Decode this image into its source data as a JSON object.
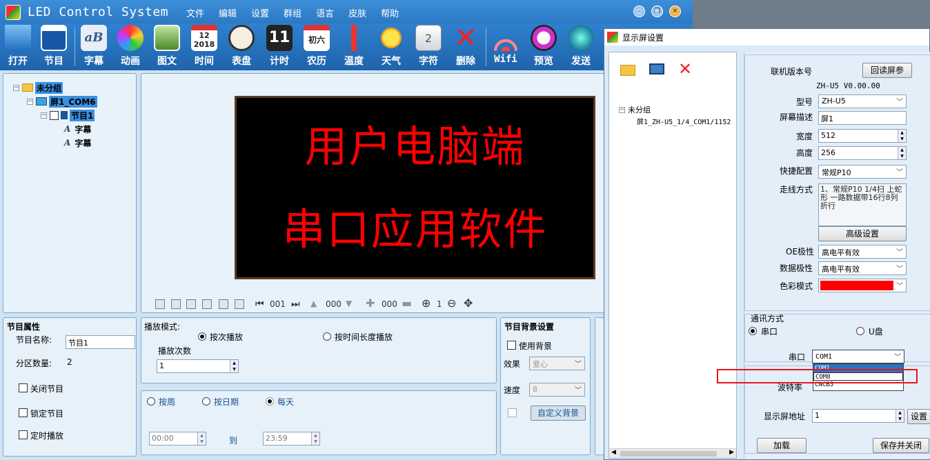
{
  "app": {
    "title": "LED Control System",
    "menu": [
      "文件",
      "编辑",
      "设置",
      "群组",
      "语言",
      "皮肤",
      "帮助"
    ],
    "win_controls": [
      "minimize-icon",
      "restore-icon",
      "close-icon"
    ]
  },
  "toolbar": [
    {
      "label": "打开",
      "icon": "open-folder-icon"
    },
    {
      "label": "节目",
      "icon": "program-icon"
    },
    {
      "label": "字幕",
      "icon": "subtitle-icon"
    },
    {
      "label": "动画",
      "icon": "animation-icon"
    },
    {
      "label": "图文",
      "icon": "image-text-icon"
    },
    {
      "label": "时间",
      "icon": "calendar-icon",
      "text": "12\n2018"
    },
    {
      "label": "表盘",
      "icon": "clock-icon"
    },
    {
      "label": "计时",
      "icon": "timer-icon",
      "text": "11"
    },
    {
      "label": "农历",
      "icon": "lunar-calendar-icon",
      "text": "初六"
    },
    {
      "label": "温度",
      "icon": "thermometer-icon"
    },
    {
      "label": "天气",
      "icon": "sun-icon"
    },
    {
      "label": "字符",
      "icon": "character-icon"
    },
    {
      "label": "删除",
      "icon": "delete-icon"
    },
    {
      "label": "Wifi",
      "icon": "wifi-icon"
    },
    {
      "label": "预览",
      "icon": "preview-icon"
    },
    {
      "label": "发送",
      "icon": "send-icon"
    }
  ],
  "tree": {
    "group": "未分组",
    "screen": "屏1_COM6",
    "program": "节目1",
    "items": [
      "字幕",
      "字幕"
    ]
  },
  "preview": {
    "line1": "用户电脑端",
    "line2": "串口应用软件"
  },
  "editbar": {
    "v1": "001",
    "v2": "000",
    "v3": "000",
    "zoom": "1"
  },
  "program_props": {
    "title": "节目属性",
    "name_label": "节目名称:",
    "name_value": "节目1",
    "count_label": "分区数量:",
    "count_value": "2",
    "close_label": "关闭节目",
    "lock_label": "锁定节目",
    "timed_label": "定时播放"
  },
  "play_mode": {
    "title": "播放模式:",
    "opt1": "按次播放",
    "opt2": "按时间长度播放",
    "times_label": "播放次数",
    "times_value": "1",
    "week": "按周",
    "date": "按日期",
    "daily": "每天",
    "from": "00:00",
    "to_label": "到",
    "to": "23:59"
  },
  "bg": {
    "title": "节目背景设置",
    "use_bg": "使用背景",
    "effect_label": "效果",
    "effect_value": "爱心",
    "speed_label": "速度",
    "speed_value": "8",
    "custom_btn": "自定义背景"
  },
  "dialog": {
    "title": "显示屏设置",
    "tree_group": "未分组",
    "tree_screen": "屏1_ZH-U5_1/4_COM1/1152",
    "version_label": "联机版本号",
    "read_btn": "回读屏参",
    "version_value": "ZH-U5  V0.00.00",
    "model_label": "型号",
    "model_value": "ZH-U5",
    "desc_label": "屏幕描述",
    "desc_value": "屏1",
    "width_label": "宽度",
    "width_value": "512",
    "height_label": "高度",
    "height_value": "256",
    "quick_label": "快捷配置",
    "quick_value": "常规P10",
    "wiring_label": "走线方式",
    "wiring_value": "1、常规P10  1/4扫 上蛇形 一路数据带16行8列折行",
    "advanced_btn": "高级设置",
    "oe_label": "OE极性",
    "oe_value": "高电平有效",
    "data_pol_label": "数据极性",
    "data_pol_value": "高电平有效",
    "color_label": "色彩模式",
    "color_value": "#ff0000",
    "comm_label": "通讯方式",
    "comm_serial": "串口",
    "comm_usb": "U盘",
    "port_label": "串口",
    "port_value": "COM1",
    "port_options": [
      "COM1",
      "COM8",
      "CNCB5"
    ],
    "baud_label": "波特率",
    "addr_label": "显示屏地址",
    "addr_value": "1",
    "set_btn": "设置",
    "load_btn": "加载",
    "save_btn": "保存并关闭"
  }
}
